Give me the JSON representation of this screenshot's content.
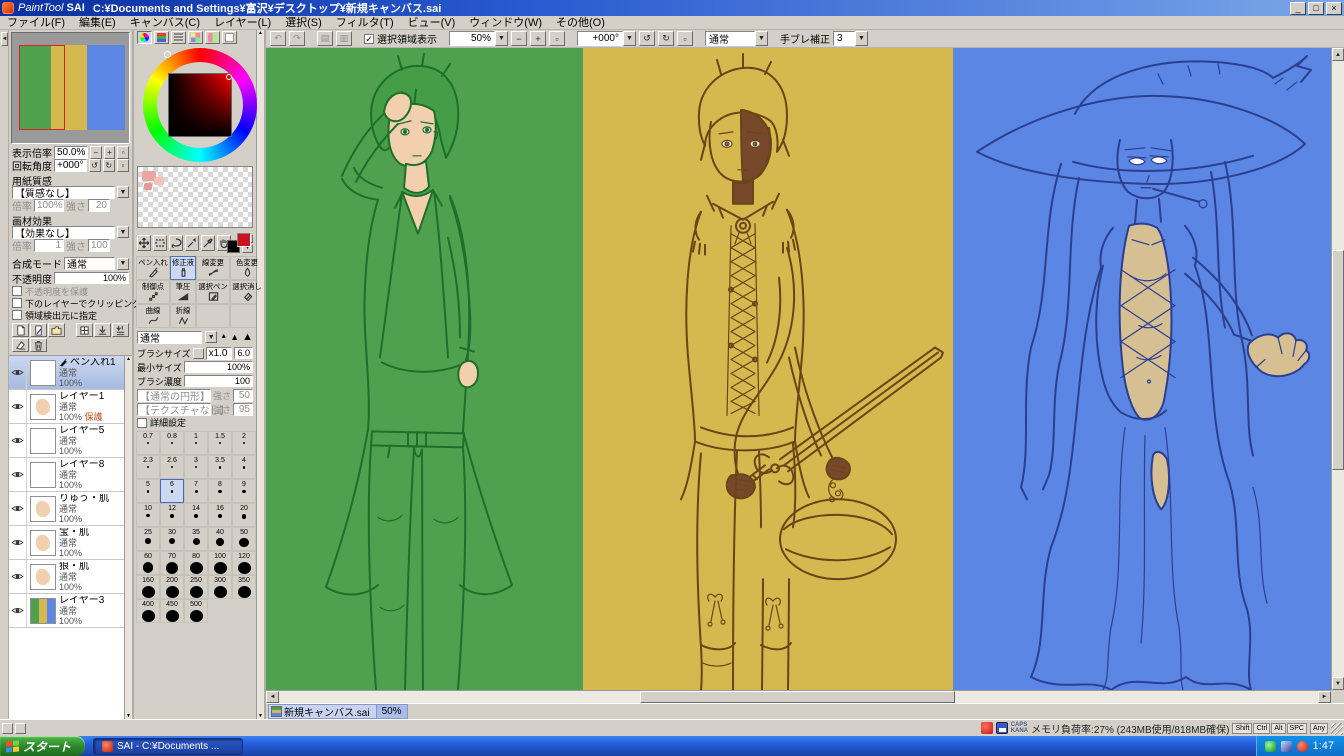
{
  "window": {
    "app_name_italic": "PaintTool",
    "app_name_bold": "SAI",
    "title_path": "C:¥Documents and Settings¥富沢¥デスクトップ¥新規キャンバス.sai",
    "buttons": {
      "minimize": "_",
      "maximize": "□",
      "close": "×"
    }
  },
  "menu": {
    "items": [
      "ファイル(F)",
      "編集(E)",
      "キャンバス(C)",
      "レイヤー(L)",
      "選択(S)",
      "フィルタ(T)",
      "ビュー(V)",
      "ウィンドウ(W)",
      "その他(O)"
    ]
  },
  "canvas_toolbar": {
    "show_selection_label": "選択領域表示",
    "zoom_value": "50%",
    "angle_value": "+000°",
    "blend_value": "通常",
    "stabilizer_label": "手ブレ補正",
    "stabilizer_value": "3"
  },
  "navigator": {
    "zoom_label": "表示倍率",
    "zoom_value": "50.0%",
    "angle_label": "回転角度",
    "angle_value": "+000°"
  },
  "paper": {
    "texture_label": "用紙質感",
    "texture_value": "【質感なし】",
    "scale_label": "倍率",
    "scale_value": "100%",
    "strength_label": "強さ",
    "strength_value": "20",
    "effect_label": "画材効果",
    "effect_value": "【効果なし】",
    "effect_scale_value": "1",
    "effect_strength_value": "100"
  },
  "layer_panel": {
    "blend_label": "合成モード",
    "blend_value": "通常",
    "opacity_label": "不透明度",
    "opacity_value": "100%",
    "protect_label": "不透明度を保護",
    "clip_label": "下のレイヤーでクリッピング",
    "source_label": "領域検出元に指定"
  },
  "layers": [
    {
      "name": "ペン入れ1",
      "blend": "通常",
      "opacity": "100%",
      "selected": true,
      "thumb": "white",
      "badge": "pen"
    },
    {
      "name": "レイヤー1",
      "blend": "通常",
      "opacity": "100%",
      "extra": "保護",
      "thumb": "skin"
    },
    {
      "name": "レイヤー5",
      "blend": "通常",
      "opacity": "100%",
      "thumb": "white"
    },
    {
      "name": "レイヤー8",
      "blend": "通常",
      "opacity": "100%",
      "thumb": "white"
    },
    {
      "name": "りゅう・肌",
      "blend": "通常",
      "opacity": "100%",
      "thumb": "skin"
    },
    {
      "name": "宝・肌",
      "blend": "通常",
      "opacity": "100%",
      "thumb": "skin"
    },
    {
      "name": "狼・肌",
      "blend": "通常",
      "opacity": "100%",
      "thumb": "skin"
    },
    {
      "name": "レイヤー3",
      "blend": "通常",
      "opacity": "100%",
      "thumb": "stripes"
    }
  ],
  "linework_tools": [
    {
      "label": "ペン入れ",
      "icon": "lw-pen"
    },
    {
      "label": "修正液",
      "icon": "lw-fluid",
      "active": true
    },
    {
      "label": "線変更",
      "icon": "lw-width"
    },
    {
      "label": "色変更",
      "icon": "lw-color"
    },
    {
      "label": "制御点",
      "icon": "lw-point"
    },
    {
      "label": "筆圧",
      "icon": "lw-pressure"
    },
    {
      "label": "選択ペン",
      "icon": "lw-selpen"
    },
    {
      "label": "選択消し",
      "icon": "lw-seleraser"
    },
    {
      "label": "曲線",
      "icon": "lw-curve"
    },
    {
      "label": "折線",
      "icon": "lw-poly"
    }
  ],
  "brush": {
    "mode_value": "通常",
    "size_label": "ブラシサイズ",
    "size_mult": "x1.0",
    "size_value": "6.0",
    "min_label": "最小サイズ",
    "min_value": "100%",
    "density_label": "ブラシ濃度",
    "density_value": "100",
    "shape_value": "【通常の円形】",
    "shape_strength_label": "強さ",
    "shape_strength_value": "50",
    "texture_value": "【テクスチャなし】",
    "texture_strength_label": "強さ",
    "texture_strength_value": "95",
    "advanced_label": "詳細設定"
  },
  "brush_sizes": {
    "values": [
      0.7,
      0.8,
      1,
      1.5,
      2,
      2.3,
      2.6,
      3,
      3.5,
      4,
      5,
      6,
      7,
      8,
      9,
      10,
      12,
      14,
      16,
      20,
      25,
      30,
      35,
      40,
      50,
      60,
      70,
      80,
      100,
      120,
      160,
      200,
      250,
      300,
      350,
      400,
      450,
      500
    ],
    "selected": 6
  },
  "canvas": {
    "panels": [
      {
        "name": "green",
        "bg": "#4fa150",
        "line": "#1e6f2a",
        "skin": "#f2cfad",
        "hair": "#459e47"
      },
      {
        "name": "yellow",
        "bg": "#d6b94e",
        "line": "#6a4517",
        "skin": "#77492a"
      },
      {
        "name": "blue",
        "bg": "#5c86e3",
        "line": "#2b3f8e",
        "skin": "#d7bf94"
      }
    ]
  },
  "statusbar": {
    "doc_name": "新規キャンバス.sai",
    "doc_zoom": "50%",
    "caps": "CAPS",
    "kana": "KANA",
    "memory": "メモリ負荷率:27% (243MB使用/818MB確保)",
    "keys": [
      "Shift",
      "Ctrl",
      "Alt",
      "SPC"
    ],
    "any_label": "Any"
  },
  "taskbar": {
    "start_label": "スタート",
    "task_label": "SAI - C:¥Documents ...",
    "clock": "1:47"
  }
}
